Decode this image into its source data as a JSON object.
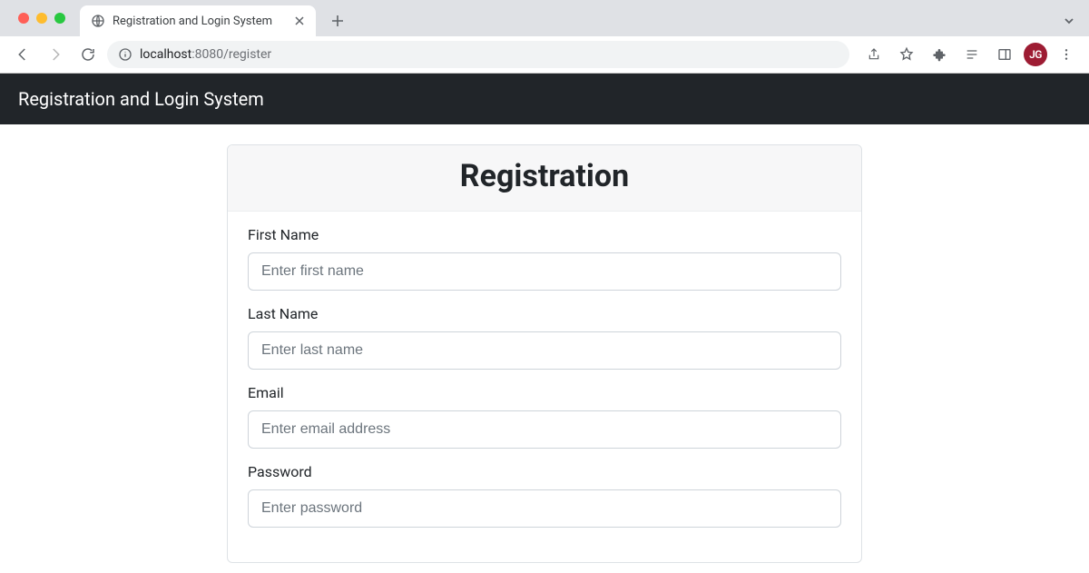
{
  "browser": {
    "tab_title": "Registration and Login System",
    "url_host": "localhost",
    "url_port_path": ":8080/register",
    "avatar_initials": "JG"
  },
  "navbar": {
    "brand": "Registration and Login System"
  },
  "card": {
    "header": "Registration"
  },
  "form": {
    "first_name": {
      "label": "First Name",
      "placeholder": "Enter first name",
      "value": ""
    },
    "last_name": {
      "label": "Last Name",
      "placeholder": "Enter last name",
      "value": ""
    },
    "email": {
      "label": "Email",
      "placeholder": "Enter email address",
      "value": ""
    },
    "password": {
      "label": "Password",
      "placeholder": "Enter password",
      "value": ""
    }
  }
}
